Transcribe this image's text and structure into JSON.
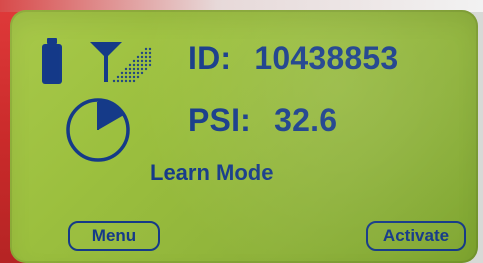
{
  "ui": {
    "id_label": "ID:",
    "id_value": "10438853",
    "psi_label": "PSI:",
    "psi_value": "32.6",
    "mode_text": "Learn Mode",
    "softkeys": {
      "left": "Menu",
      "right": "Activate"
    }
  },
  "icons": {
    "battery": "battery-icon",
    "signal": "signal-icon",
    "gauge": "pressure-gauge-icon"
  },
  "colors": {
    "lcd_ink": "#153a88",
    "lcd_green": "#9bbf3e",
    "accent_red": "#c92a2a"
  }
}
